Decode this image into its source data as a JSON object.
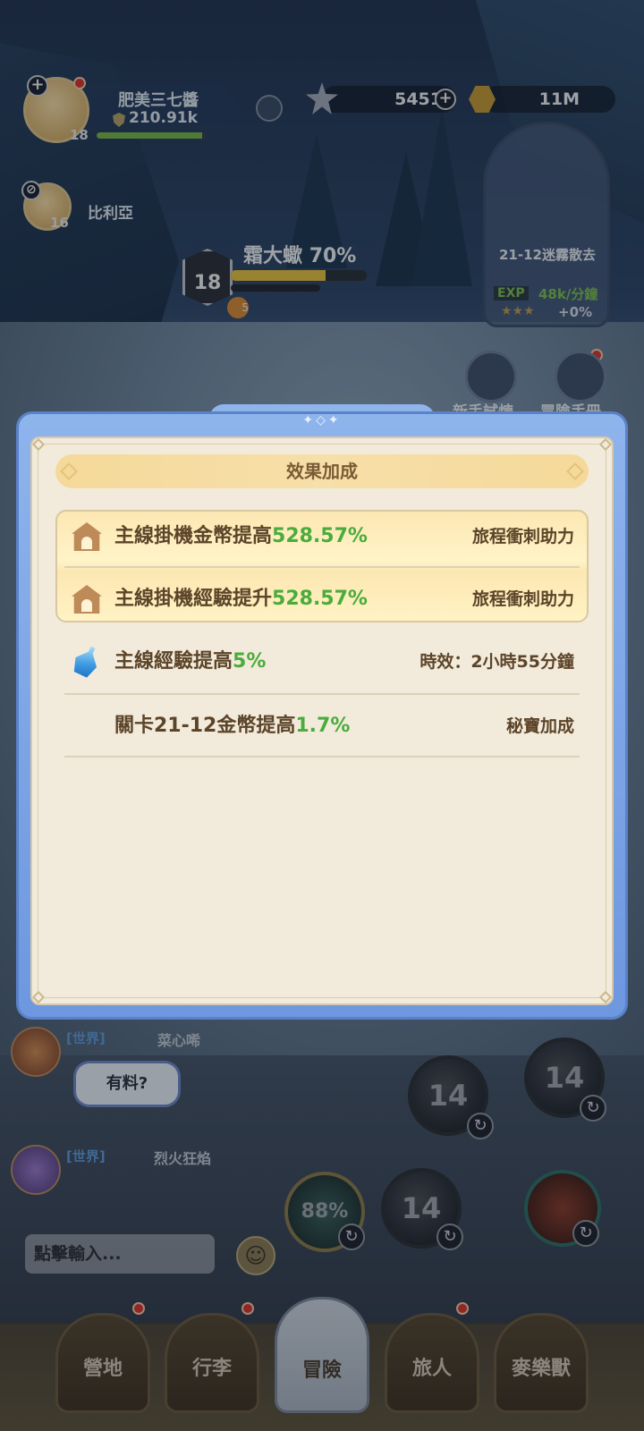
{
  "player": {
    "name": "肥美三七醬",
    "power": "210.91k",
    "level": "18",
    "exp_progress": 0.95
  },
  "companion": {
    "name": "比利亞",
    "level": "16"
  },
  "resources": {
    "gems": "5451",
    "gold": "11M"
  },
  "stage_card": {
    "stage_name": "21-12迷霧散去",
    "exp_tag": "EXP",
    "exp_rate": "48k/分鐘",
    "stars": "★★★",
    "bonus": "+0%"
  },
  "boss": {
    "level": "18",
    "name": "霜大蠍",
    "hp_percent": "70%",
    "hp_fraction": 0.7,
    "mark_count": "5"
  },
  "side_buttons": {
    "newbie_trial": "新手試煉",
    "adventure_handbook": "冒險手冊"
  },
  "chat": {
    "channel_tag": "[世界]",
    "messages": [
      {
        "user": "菜心唏",
        "text": "有料?"
      },
      {
        "user": "烈火狂焰",
        "text": ""
      }
    ],
    "input_placeholder": "點擊輸入..."
  },
  "skills": {
    "skill_1": "14",
    "skill_2": "14",
    "skill_3": "88%",
    "skill_4": "14"
  },
  "nav": {
    "tabs": [
      "營地",
      "行李",
      "冒險",
      "旅人",
      "麥樂獸"
    ],
    "active": "冒險"
  },
  "modal": {
    "title": "效果加成",
    "rows": [
      {
        "label": "主線掛機金幣提高",
        "value": "528.57%",
        "source": "旅程衝刺助力",
        "icon": "camp-base-icon"
      },
      {
        "label": "主線掛機經驗提升",
        "value": "528.57%",
        "source": "旅程衝刺助力",
        "icon": "camp-base-icon"
      },
      {
        "label": "主線經驗提高",
        "value": "5%",
        "source": "時效：2小時55分鐘",
        "icon": "blue-potion-icon"
      },
      {
        "label": "關卡21-12金幣提高",
        "value": "1.7%",
        "source": "秘寶加成",
        "icon": ""
      }
    ]
  },
  "colors": {
    "modal_frame": "#8fb4ec",
    "modal_body": "#f2ebdb",
    "value_green": "#4aac3c",
    "text_brown": "#5c4429"
  }
}
